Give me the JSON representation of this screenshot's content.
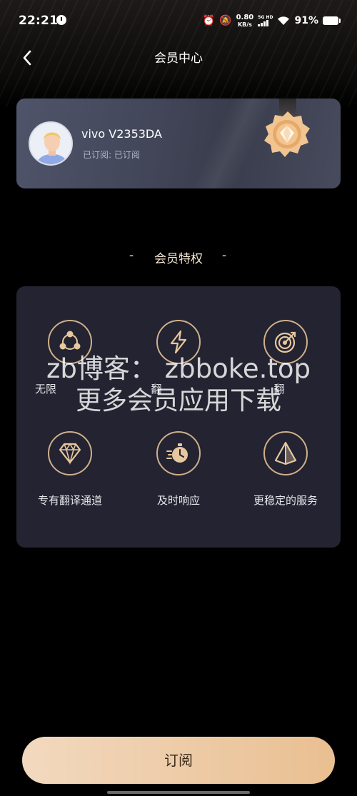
{
  "status_bar": {
    "time": "22:21",
    "net_speed_value": "0.80",
    "net_speed_unit": "KB/s",
    "signal_label": "5G HD",
    "battery": "91%"
  },
  "nav": {
    "title": "会员中心"
  },
  "card": {
    "username": "vivo V2353DA",
    "status": "已订阅: 已订阅"
  },
  "section": {
    "title": "会员特权",
    "dash": "-"
  },
  "privileges": [
    {
      "label": "无限",
      "icon": "network-icon"
    },
    {
      "label": "翻",
      "icon": "lightning-icon"
    },
    {
      "label": "翻",
      "icon": "target-icon"
    },
    {
      "label": "专有翻译通道",
      "icon": "diamond-icon"
    },
    {
      "label": "及时响应",
      "icon": "stopwatch-icon"
    },
    {
      "label": "更稳定的服务",
      "icon": "pyramid-icon"
    }
  ],
  "watermark": {
    "line1": "zb博客： zbboke.top",
    "line2": "更多会员应用下载"
  },
  "subscribe": {
    "label": "订阅"
  },
  "colors": {
    "accent_gold": "#cfb08a",
    "button_start": "#f2d9bf",
    "button_end": "#e9bf91",
    "panel": "#232331"
  }
}
